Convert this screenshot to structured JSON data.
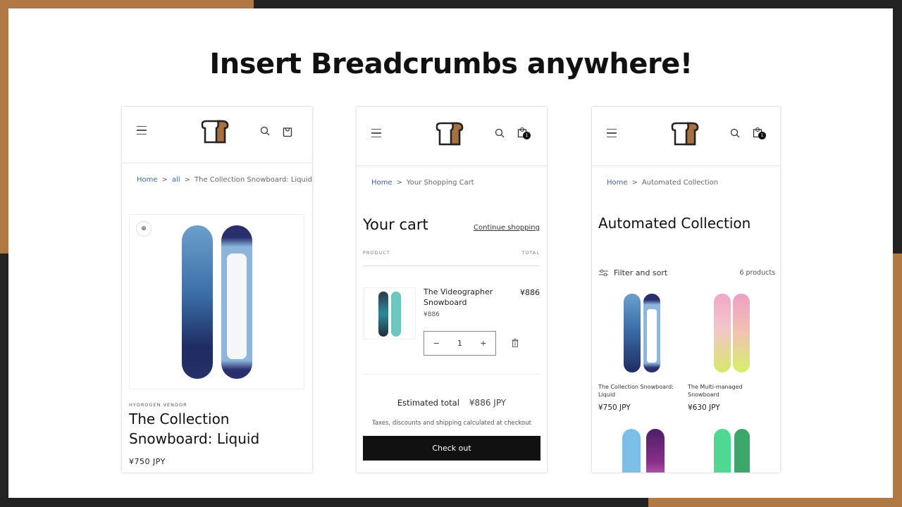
{
  "headline": "Insert Breadcrumbs anywhere!",
  "colors": {
    "accent_orange": "#b27843",
    "dark_bg": "#222222",
    "link_blue": "#3b65a8",
    "button_black": "#111111"
  },
  "product_page": {
    "breadcrumb": [
      {
        "label": "Home"
      },
      {
        "label": "all"
      },
      {
        "label": "The Collection Snowboard: Liquid"
      }
    ],
    "separator": ">",
    "vendor": "HYDROGEN VENDOR",
    "title": "The Collection Snowboard: Liquid",
    "price": "¥750 JPY",
    "icons": [
      "menu-icon",
      "search-icon",
      "cart-icon",
      "zoom-in-icon"
    ]
  },
  "cart_page": {
    "breadcrumb": [
      {
        "label": "Home"
      },
      {
        "label": "Your Shopping Cart"
      }
    ],
    "separator": ">",
    "cart_count": "1",
    "title": "Your cart",
    "continue_shopping": "Continue shopping",
    "col_product": "PRODUCT",
    "col_total": "TOTAL",
    "item": {
      "name": "The Videographer Snowboard",
      "unit_price": "¥886",
      "quantity": "1",
      "total": "¥886",
      "minus": "−",
      "plus": "+"
    },
    "estimated_total_label": "Estimated total",
    "estimated_total_value": "¥886 JPY",
    "tax_note": "Taxes, discounts and shipping calculated at checkout",
    "checkout_label": "Check out"
  },
  "collection_page": {
    "breadcrumb": [
      {
        "label": "Home"
      },
      {
        "label": "Automated Collection"
      }
    ],
    "separator": ">",
    "cart_count": "1",
    "title": "Automated Collection",
    "filter_label": "Filter and sort",
    "product_count": "6 products",
    "products": [
      {
        "name": "The Collection Snowboard: Liquid",
        "price": "¥750 JPY"
      },
      {
        "name": "The Multi-managed Snowboard",
        "price": "¥630 JPY"
      }
    ]
  }
}
